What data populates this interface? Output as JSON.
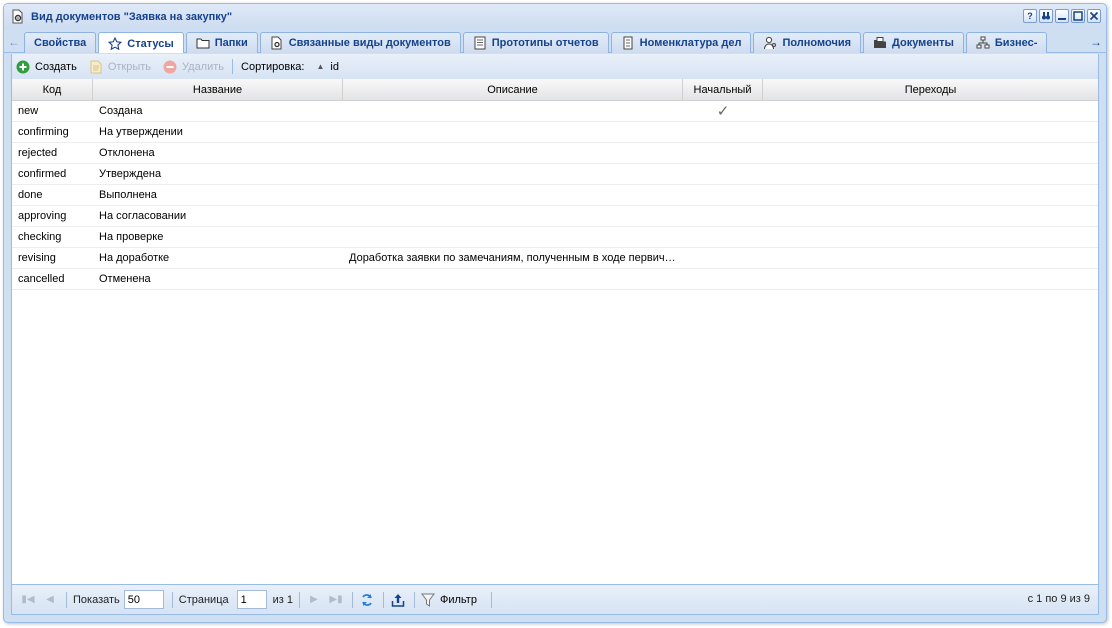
{
  "window": {
    "title": "Вид документов \"Заявка на закупку\"",
    "icon": "document-settings-icon",
    "tools": [
      "help-icon",
      "binoculars-icon",
      "minimize-icon",
      "maximize-icon",
      "close-icon"
    ]
  },
  "tabs": [
    {
      "label": "Свойства",
      "icon": "",
      "active": false
    },
    {
      "label": "Статусы",
      "icon": "star-icon",
      "active": true
    },
    {
      "label": "Папки",
      "icon": "folder-icon",
      "active": false
    },
    {
      "label": "Связанные виды документов",
      "icon": "document-gear-icon",
      "active": false
    },
    {
      "label": "Прототипы отчетов",
      "icon": "report-icon",
      "active": false
    },
    {
      "label": "Номенклатура дел",
      "icon": "nomenclature-icon",
      "active": false
    },
    {
      "label": "Полномочия",
      "icon": "user-key-icon",
      "active": false
    },
    {
      "label": "Документы",
      "icon": "documents-folder-icon",
      "active": false
    },
    {
      "label": "Бизнес-",
      "icon": "org-chart-icon",
      "active": false
    }
  ],
  "toolbar": {
    "create": "Создать",
    "open": "Открыть",
    "delete": "Удалить",
    "sort_label": "Сортировка:",
    "sort_field": "id"
  },
  "grid": {
    "columns": [
      "Код",
      "Название",
      "Описание",
      "Начальный",
      "Переходы"
    ],
    "rows": [
      {
        "code": "new",
        "name": "Создана",
        "description": "",
        "initial": "✓",
        "transitions": ""
      },
      {
        "code": "confirming",
        "name": "На утверждении",
        "description": "",
        "initial": "",
        "transitions": ""
      },
      {
        "code": "rejected",
        "name": "Отклонена",
        "description": "",
        "initial": "",
        "transitions": ""
      },
      {
        "code": "confirmed",
        "name": "Утверждена",
        "description": "",
        "initial": "",
        "transitions": ""
      },
      {
        "code": "done",
        "name": "Выполнена",
        "description": "",
        "initial": "",
        "transitions": ""
      },
      {
        "code": "approving",
        "name": "На согласовании",
        "description": "",
        "initial": "",
        "transitions": ""
      },
      {
        "code": "checking",
        "name": "На проверке",
        "description": "",
        "initial": "",
        "transitions": ""
      },
      {
        "code": "revising",
        "name": "На доработке",
        "description": "Доработка заявки по замечаниям, полученным в ходе первич…",
        "initial": "",
        "transitions": ""
      },
      {
        "code": "cancelled",
        "name": "Отменена",
        "description": "",
        "initial": "",
        "transitions": ""
      }
    ]
  },
  "pager": {
    "show_label": "Показать",
    "page_size": "50",
    "page_label": "Страница",
    "page": "1",
    "of_pages": "из 1",
    "filter": "Фильтр",
    "summary": "с 1 по 9 из 9"
  },
  "colors": {
    "accent": "#15428b",
    "create_green": "#2e9e3e",
    "delete_red": "#e0584f"
  }
}
